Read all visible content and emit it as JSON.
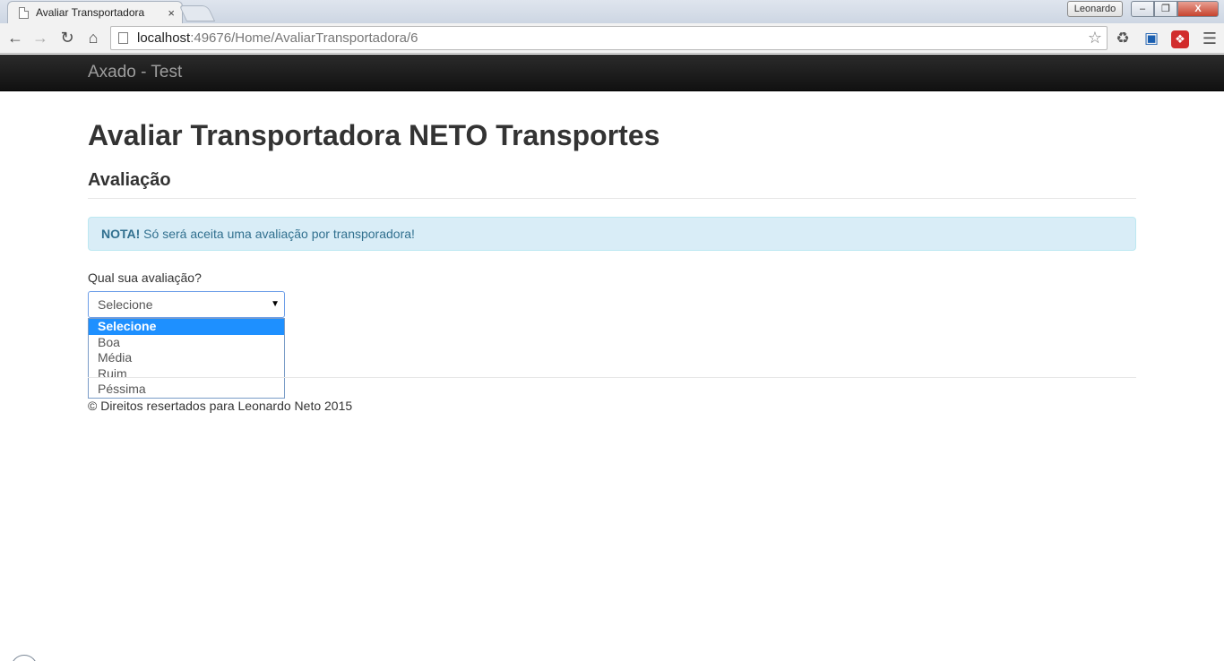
{
  "browser": {
    "tab_title": "Avaliar Transportadora",
    "tab_close": "×",
    "user_name": "Leonardo",
    "url_host": "localhost",
    "url_path": ":49676/Home/AvaliarTransportadora/6",
    "window_min": "–",
    "window_max": "❐",
    "window_close": "X",
    "icons": [
      "back-icon",
      "forward-icon",
      "reload-icon",
      "home-icon",
      "bookmark-star-icon",
      "recycle-extension-icon",
      "screen-capture-icon",
      "red-extension-icon",
      "menu-icon"
    ]
  },
  "navbar": {
    "brand": "Axado - Test"
  },
  "page": {
    "title": "Avaliar Transportadora NETO Transportes",
    "section": "Avaliação",
    "alert_strong": "NOTA!",
    "alert_text": " Só será aceita uma avaliação por transporadora!",
    "question": "Qual sua avaliação?",
    "select_value": "Selecione",
    "options": [
      "Selecione",
      "Boa",
      "Média",
      "Ruim",
      "Péssima"
    ],
    "footer": "© Direitos resertados para Leonardo Neto 2015"
  },
  "colors": {
    "navbar": "#222222",
    "brand": "#9d9d9d",
    "alert_bg": "#d9edf7",
    "alert_text": "#31708f",
    "option_highlight": "#1e90ff"
  }
}
